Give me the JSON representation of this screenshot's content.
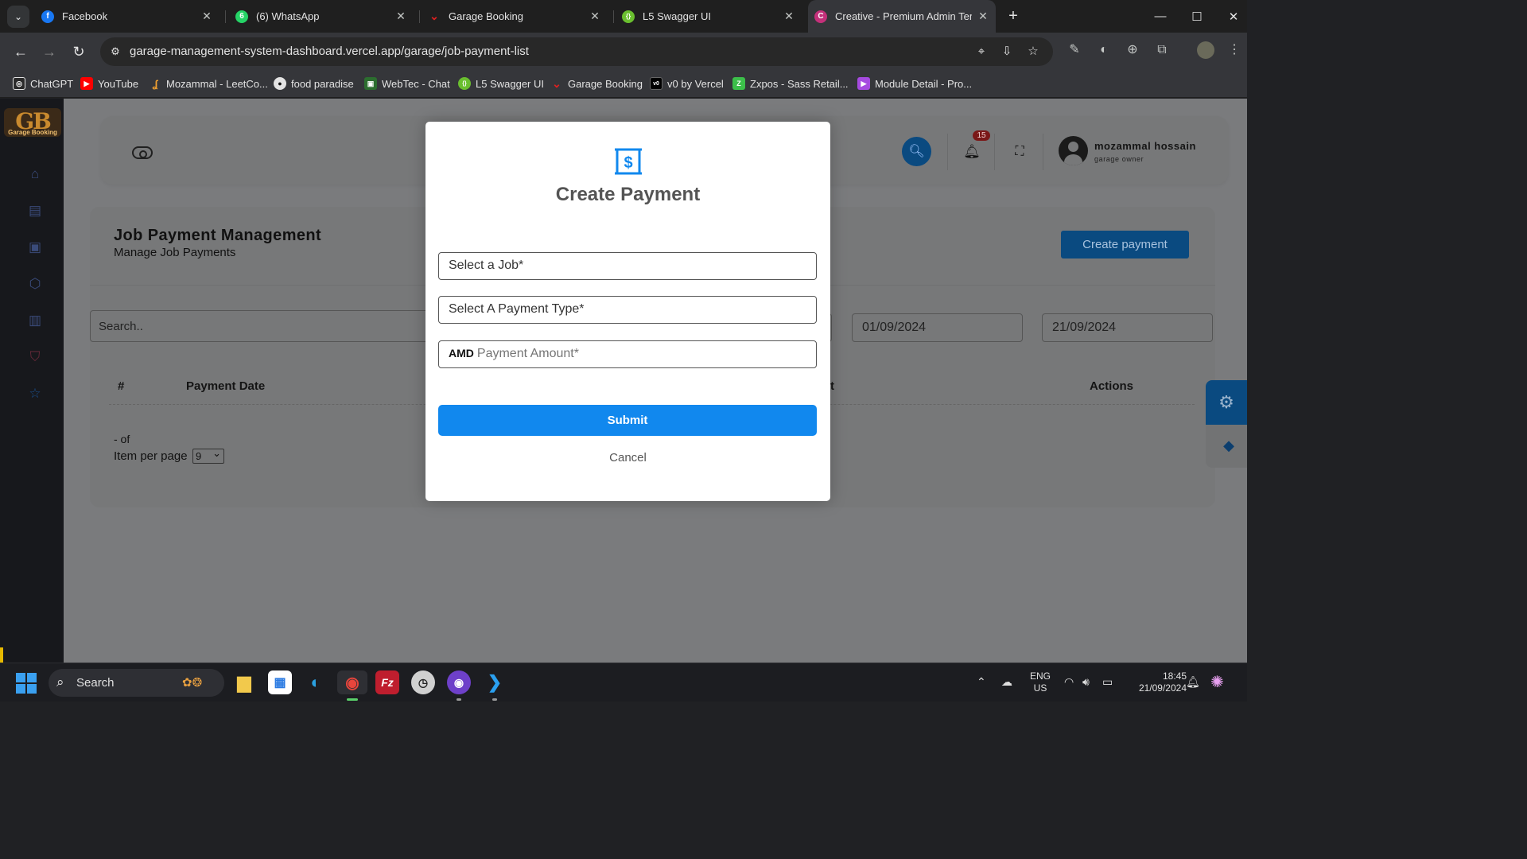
{
  "browser": {
    "tabs": [
      {
        "title": "Facebook",
        "icon": "facebook-icon",
        "color": "#1877f2",
        "glyph": "f"
      },
      {
        "title": "(6) WhatsApp",
        "icon": "whatsapp-icon",
        "color": "#25d366",
        "glyph": "6"
      },
      {
        "title": "Garage Booking",
        "icon": "garage-booking-icon",
        "color": "#e02020",
        "glyph": "⌄"
      },
      {
        "title": "L5 Swagger UI",
        "icon": "swagger-icon",
        "color": "#6abf2f",
        "glyph": "{}"
      },
      {
        "title": "Creative - Premium Admin Temp",
        "icon": "creative-icon",
        "color": "#c4307a",
        "glyph": "C",
        "active": true
      }
    ],
    "url_host": "garage-management-system-dashboard.vercel.app",
    "url_path": "/garage/job-payment-list",
    "bookmarks": [
      {
        "label": "ChatGPT",
        "icon": "chatgpt-icon",
        "color": "#e3e3e3"
      },
      {
        "label": "YouTube",
        "icon": "youtube-icon",
        "color": "#ff0000"
      },
      {
        "label": "Mozammal - LeetCo...",
        "icon": "leetcode-icon",
        "color": "#f0a030"
      },
      {
        "label": "food paradise",
        "icon": "github-icon",
        "color": "#e3e3e3"
      },
      {
        "label": "WebTec - Chat",
        "icon": "chat-icon",
        "color": "#4caf50"
      },
      {
        "label": "L5 Swagger UI",
        "icon": "swagger-icon",
        "color": "#6abf2f"
      },
      {
        "label": "Garage Booking",
        "icon": "garage-booking-icon",
        "color": "#e02020"
      },
      {
        "label": "v0 by Vercel",
        "icon": "v0-icon",
        "color": "#000000"
      },
      {
        "label": "Zxpos - Sass Retail...",
        "icon": "zxpos-icon",
        "color": "#3cbf4a"
      },
      {
        "label": "Module Detail - Pro...",
        "icon": "module-icon",
        "color": "#a64ae0"
      }
    ]
  },
  "app": {
    "logo_text": "GB",
    "logo_sub": "Garage Booking",
    "notification_count": "15",
    "user_name": "mozammal hossain",
    "user_role": "garage owner",
    "page_title": "Job Payment Management",
    "page_subtitle": "Manage Job Payments",
    "create_button": "Create payment",
    "search_placeholder": "Search..",
    "date_from": "01/09/2024",
    "date_to": "21/09/2024",
    "table_headers": {
      "index": "#",
      "payment_date": "Payment Date",
      "amount_fragment": "t",
      "actions": "Actions"
    },
    "pagination_of": "- of",
    "items_per_page_label": "Item per page",
    "items_per_page_value": "9"
  },
  "modal": {
    "title": "Create Payment",
    "job_placeholder": "Select a Job*",
    "payment_type_placeholder": "Select A Payment Type*",
    "currency_prefix": "AMD",
    "amount_placeholder": "Payment Amount*",
    "submit_label": "Submit",
    "cancel_label": "Cancel",
    "accent_color": "#1188ee"
  },
  "taskbar": {
    "search_label": "Search",
    "lang_line1": "ENG",
    "lang_line2": "US",
    "time": "18:45",
    "date": "21/09/2024"
  }
}
